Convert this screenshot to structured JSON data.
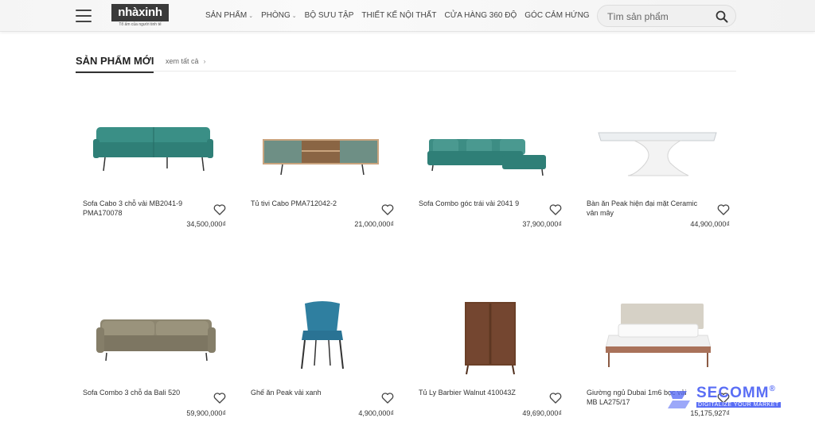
{
  "header": {
    "logo_text": "nhàxinh",
    "logo_tagline": "Tổ ấm của người tinh tế",
    "nav": [
      {
        "label": "SẢN PHẨM",
        "dropdown": true
      },
      {
        "label": "PHÒNG",
        "dropdown": true
      },
      {
        "label": "BỘ SƯU TẬP",
        "dropdown": false
      },
      {
        "label": "THIẾT KẾ NỘI THẤT",
        "dropdown": false
      },
      {
        "label": "CỬA HÀNG 360 ĐỘ",
        "dropdown": false
      },
      {
        "label": "GÓC CẢM HỨNG",
        "dropdown": false
      }
    ],
    "search_placeholder": "Tìm sản phẩm"
  },
  "section": {
    "title": "SẢN PHẨM MỚI",
    "see_all": "xem tất cả"
  },
  "products": [
    {
      "name": "Sofa Cabo 3 chỗ vải MB2041-9 PMA170078",
      "price": "34,500,000₫",
      "icon": "sofa-teal"
    },
    {
      "name": "Tủ tivi Cabo PMA712042-2",
      "price": "21,000,000₫",
      "icon": "tv-cabinet"
    },
    {
      "name": "Sofa Combo góc trái vải 2041 9",
      "price": "37,900,000₫",
      "icon": "corner-sofa"
    },
    {
      "name": "Bàn ăn Peak hiện đại mặt Ceramic vân mây",
      "price": "44,900,000₫",
      "icon": "dining-table"
    },
    {
      "name": "Sofa Combo 3 chỗ da Bali 520",
      "price": "59,900,000₫",
      "icon": "sofa-taupe"
    },
    {
      "name": "Ghế ăn Peak vải xanh",
      "price": "4,900,000₫",
      "icon": "dining-chair"
    },
    {
      "name": "Tủ Ly Barbier Walnut 410043Z",
      "price": "49,690,000₫",
      "icon": "wood-cabinet"
    },
    {
      "name": "Giường ngủ Dubai 1m6 bọc vải MB LA275/17",
      "price": "15,175,927₫",
      "icon": "bed"
    }
  ],
  "watermark": {
    "brand": "SECOMM",
    "tagline": "DIGITALIZE YOUR MARKET",
    "registered": "®"
  },
  "colors": {
    "accent_dark": "#333333",
    "teal": "#2f8a80",
    "watermark": "#5a6ef5"
  }
}
